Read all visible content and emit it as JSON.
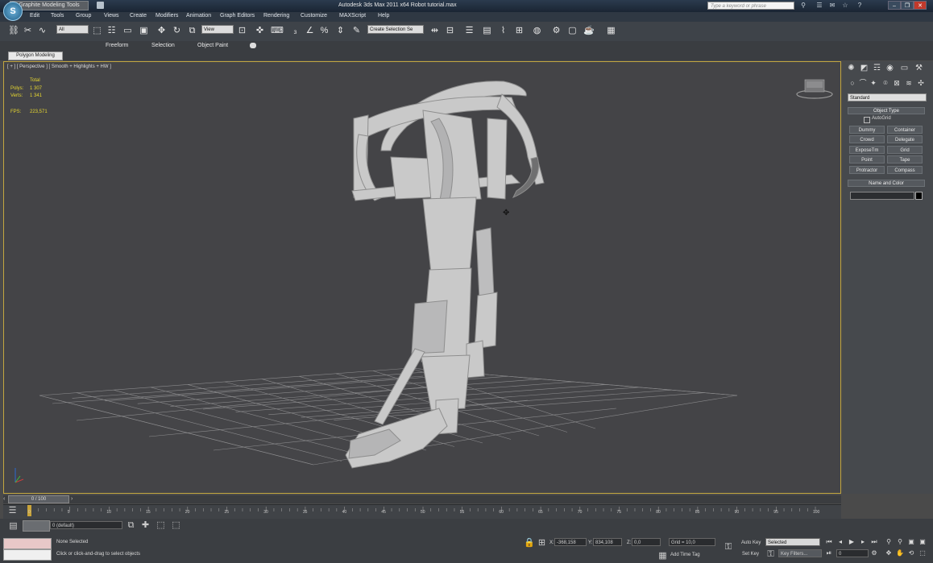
{
  "window": {
    "title": "Autodesk 3ds Max  2011 x64       Robot tutorial.max",
    "search_placeholder": "Type a keyword or phrase",
    "app_button": "S"
  },
  "menu": [
    "Edit",
    "Tools",
    "Group",
    "Views",
    "Create",
    "Modifiers",
    "Animation",
    "Graph Editors",
    "Rendering",
    "Customize",
    "MAXScript",
    "Help"
  ],
  "toolbar": {
    "selection_filter": "All",
    "ref_coord": "View",
    "named_selection": "Create Selection Se"
  },
  "ribbon": {
    "tabs": [
      "Graphite Modeling Tools",
      "Freeform",
      "Selection",
      "Object Paint"
    ],
    "sub_tab": "Polygon Modeling"
  },
  "viewport": {
    "label": "[ + ] [ Perspective ] [ Smooth + Highlights + HW ]",
    "stats": {
      "total_label": "Total",
      "polys_label": "Polys:",
      "polys_value": "1 307",
      "verts_label": "Verts:",
      "verts_value": "1 341",
      "fps_label": "FPS:",
      "fps_value": "223,571"
    }
  },
  "command_panel": {
    "category": "Standard",
    "object_type_title": "Object Type",
    "autogrid": "AutoGrid",
    "buttons": [
      "Dummy",
      "Container",
      "Crowd",
      "Delegate",
      "ExposeTm",
      "Grid",
      "Point",
      "Tape",
      "Protractor",
      "Compass"
    ],
    "name_color_title": "Name and Color"
  },
  "timeline": {
    "frame_counter": "0 / 100",
    "ticks": [
      "0",
      "5",
      "10",
      "15",
      "20",
      "25",
      "30",
      "35",
      "40",
      "45",
      "50",
      "55",
      "60",
      "65",
      "70",
      "75",
      "80",
      "85",
      "90",
      "95",
      "100"
    ]
  },
  "status": {
    "layer": "0 (default)",
    "maxscript_line": "Welcome to MAX",
    "selection": "None Selected",
    "prompt": "Click or click-and-drag to select objects",
    "x_label": "X:",
    "x_value": "-368,158",
    "y_label": "Y:",
    "y_value": "834,108",
    "z_label": "Z:",
    "z_value": "0,0",
    "grid": "Grid = 10,0",
    "add_time_tag": "Add Time Tag",
    "auto_key": "Auto Key",
    "set_key": "Set Key",
    "key_mode": "Selected",
    "key_filters": "Key Filters...",
    "frame": "0"
  },
  "colors": {
    "viewport_bg": "#444447",
    "active_border": "#c2a640",
    "stats_text": "#e8d830",
    "model": "#c9c9c9"
  }
}
